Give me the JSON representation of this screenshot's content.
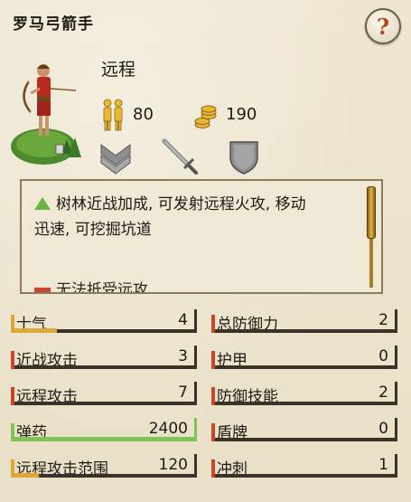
{
  "unit": {
    "name": "罗马弓箭手",
    "type": "远程",
    "men": "80",
    "cost": "190"
  },
  "icons": {
    "help": "?",
    "men": "soldiers-icon",
    "cost": "gold-coins-icon",
    "rank": "chevron-rank-icon",
    "weapon": "sword-icon",
    "armor": "shield-icon"
  },
  "description": {
    "line1": "树林近战加成, 可发射远程火攻, 移动",
    "line2": "迅速, 可挖掘坑道",
    "line3": "无法抵受远攻"
  },
  "stats": {
    "left": [
      {
        "name": "士气",
        "value": "4",
        "level": 0.25,
        "color": "#e0a636"
      },
      {
        "name": "近战攻击",
        "value": "3",
        "level": 0.0,
        "color": "#c8462e"
      },
      {
        "name": "远程攻击",
        "value": "7",
        "level": 0.0,
        "color": "#c8462e"
      },
      {
        "name": "弹药",
        "value": "2400",
        "level": 1.0,
        "color": "#7ec35a"
      },
      {
        "name": "远程攻击范围",
        "value": "120",
        "level": 0.15,
        "color": "#e0a636"
      }
    ],
    "right": [
      {
        "name": "总防御力",
        "value": "2",
        "level": 0.0,
        "color": "#c8462e"
      },
      {
        "name": "护甲",
        "value": "0",
        "level": 0.0,
        "color": "#c8462e"
      },
      {
        "name": "防御技能",
        "value": "2",
        "level": 0.0,
        "color": "#c8462e"
      },
      {
        "name": "盾牌",
        "value": "0",
        "level": 0.0,
        "color": "#c8462e"
      },
      {
        "name": "冲刺",
        "value": "1",
        "level": 0.0,
        "color": "#c8462e"
      }
    ]
  }
}
